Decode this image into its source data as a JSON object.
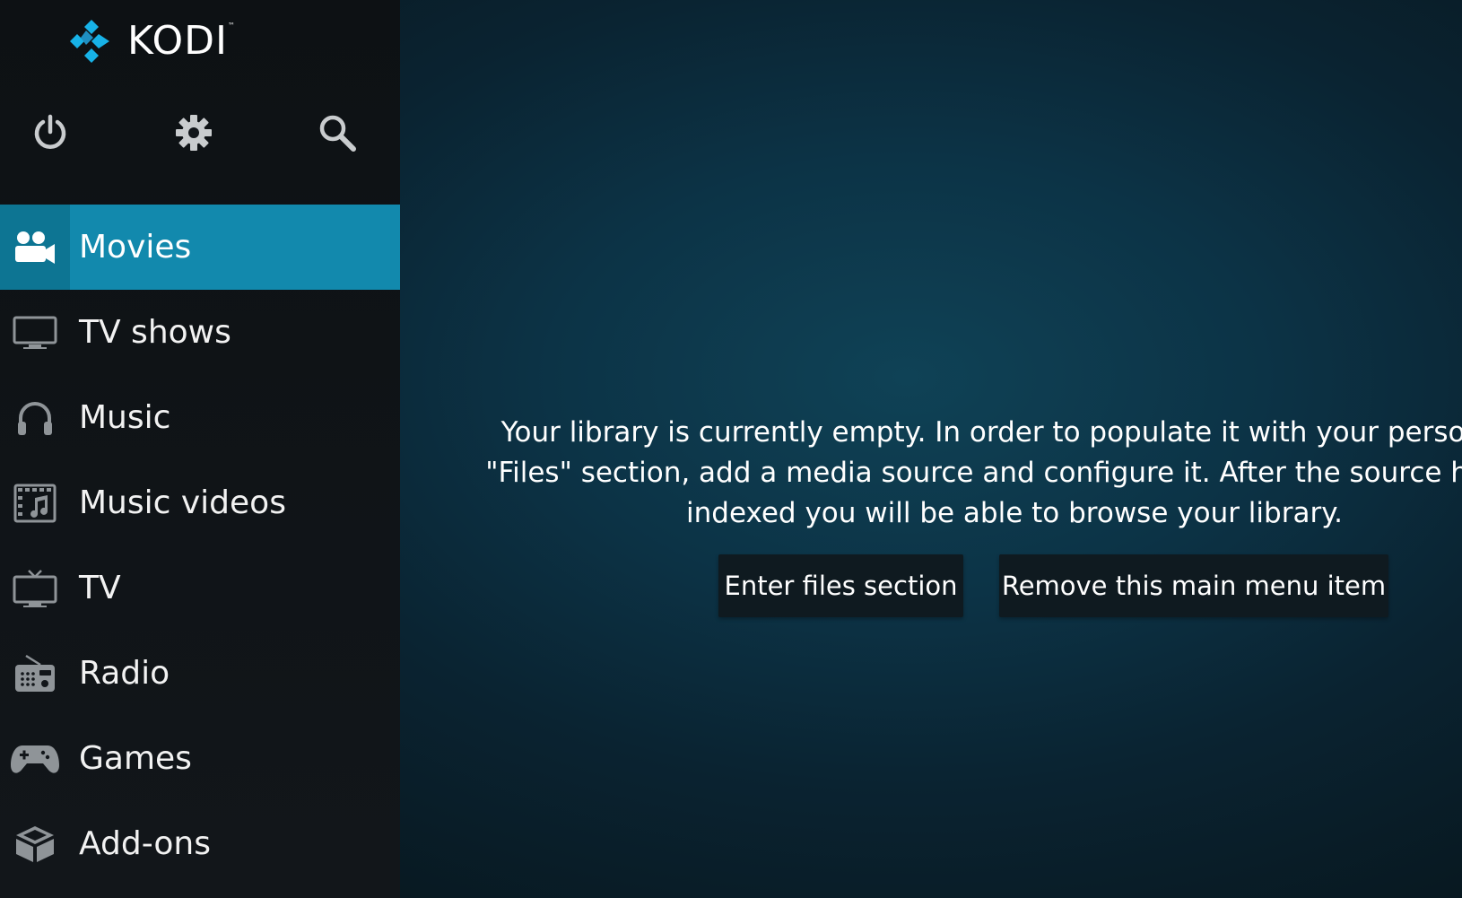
{
  "app": {
    "logo_text": "KODI",
    "logo_tm": "™"
  },
  "top_icons": [
    {
      "name": "power-icon"
    },
    {
      "name": "gear-icon"
    },
    {
      "name": "search-icon"
    }
  ],
  "menu": {
    "items": [
      {
        "label": "Movies",
        "icon": "movie-camera-icon",
        "active": true
      },
      {
        "label": "TV shows",
        "icon": "monitor-icon",
        "active": false
      },
      {
        "label": "Music",
        "icon": "headphones-icon",
        "active": false
      },
      {
        "label": "Music videos",
        "icon": "music-video-icon",
        "active": false
      },
      {
        "label": "TV",
        "icon": "tv-antenna-icon",
        "active": false
      },
      {
        "label": "Radio",
        "icon": "radio-icon",
        "active": false
      },
      {
        "label": "Games",
        "icon": "gamepad-icon",
        "active": false
      },
      {
        "label": "Add-ons",
        "icon": "addons-box-icon",
        "active": false
      }
    ]
  },
  "main": {
    "message_lines": [
      "Your library is currently empty. In order to populate it with your personal r",
      "\"Files\" section, add a media source and configure it. After the source has be",
      "indexed you will be able to browse your library."
    ],
    "enter_files_label": "Enter files section",
    "remove_item_label": "Remove this main menu item"
  },
  "colors": {
    "accent": "#1289ad",
    "accent_dark": "#0d7593",
    "sidebar_bg": "#12161a",
    "button_bg": "#0f1a20",
    "logo_blue": "#17b2e7"
  }
}
